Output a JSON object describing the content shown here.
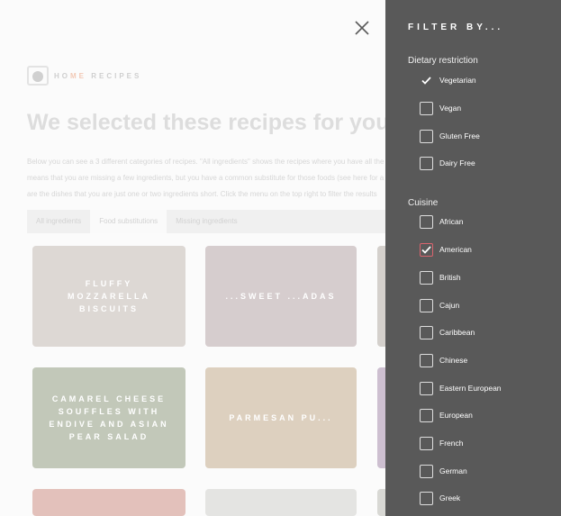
{
  "brand": {
    "part1": "HO",
    "part2": "ME",
    "part3": " RECIPES"
  },
  "headline": "We selected these recipes for you",
  "intro_lines": [
    "Below you can see a 3 different categories of recipes. \"All ingredients\" shows the recipes where you have all the",
    "means that you are missing a few ingredients, but you have a common substitute for those foods (see here for a",
    "are the dishes that you are just one or two ingredients short. Click the menu on the top right to filter the results"
  ],
  "tabs": [
    "All ingredients",
    "Food substitutions",
    "Missing ingredients"
  ],
  "active_tab": "Food substitutions",
  "recipes": [
    {
      "title": "Fluffy Mozzarella Biscuits",
      "color": "#d9d4cf"
    },
    {
      "title": "...Sweet ...Adas",
      "color": "#d3c6c9"
    },
    {
      "title": "Camarel Cheese Souffles with Endive and Asian Pear Salad",
      "color": "#b7c0ad"
    },
    {
      "title": "Parmesan Pu...",
      "color": "#d9c7ae"
    }
  ],
  "filter": {
    "title": "FILTER BY...",
    "dietary_label": "Dietary restriction",
    "dietary": [
      {
        "label": "Vegetarian",
        "checked": true,
        "style": "plain"
      },
      {
        "label": "Vegan",
        "checked": false
      },
      {
        "label": "Gluten Free",
        "checked": false
      },
      {
        "label": "Dairy Free",
        "checked": false
      }
    ],
    "cuisine_label": "Cuisine",
    "cuisine": [
      {
        "label": "African",
        "checked": false
      },
      {
        "label": "American",
        "checked": true
      },
      {
        "label": "British",
        "checked": false
      },
      {
        "label": "Cajun",
        "checked": false
      },
      {
        "label": "Caribbean",
        "checked": false
      },
      {
        "label": "Chinese",
        "checked": false
      },
      {
        "label": "Eastern European",
        "checked": false
      },
      {
        "label": "European",
        "checked": false
      },
      {
        "label": "French",
        "checked": false
      },
      {
        "label": "German",
        "checked": false
      },
      {
        "label": "Greek",
        "checked": false
      }
    ]
  },
  "colors": {
    "panel": "#595959",
    "accent_check": "#d9646e",
    "page": "#fbfbfb"
  }
}
